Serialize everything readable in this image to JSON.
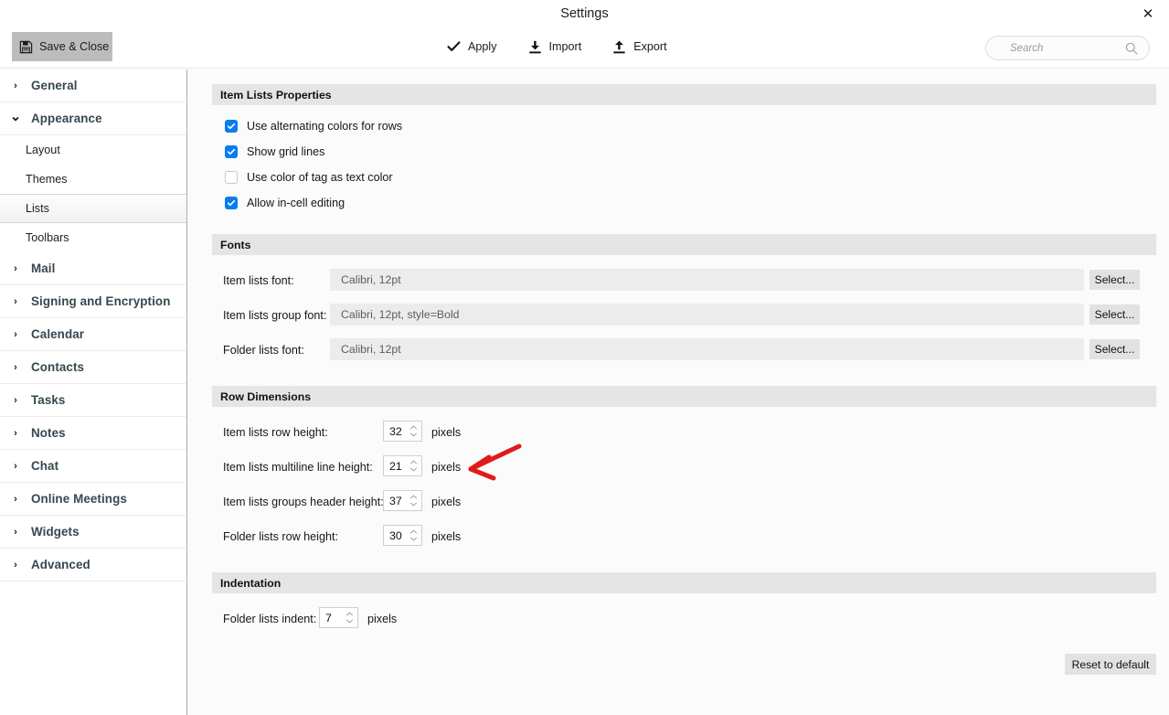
{
  "window": {
    "title": "Settings",
    "close_label": "✕"
  },
  "toolbar": {
    "save_close_label": "Save & Close",
    "apply_label": "Apply",
    "import_label": "Import",
    "export_label": "Export",
    "search_placeholder": "Search",
    "search_value": ""
  },
  "sidebar": {
    "items": [
      {
        "label": "General",
        "type": "group",
        "expanded": false
      },
      {
        "label": "Appearance",
        "type": "group",
        "expanded": true
      },
      {
        "label": "Layout",
        "type": "sub",
        "selected": false
      },
      {
        "label": "Themes",
        "type": "sub",
        "selected": false
      },
      {
        "label": "Lists",
        "type": "sub",
        "selected": true
      },
      {
        "label": "Toolbars",
        "type": "sub",
        "selected": false
      },
      {
        "label": "Mail",
        "type": "group",
        "expanded": false
      },
      {
        "label": "Signing and Encryption",
        "type": "group",
        "expanded": false
      },
      {
        "label": "Calendar",
        "type": "group",
        "expanded": false
      },
      {
        "label": "Contacts",
        "type": "group",
        "expanded": false
      },
      {
        "label": "Tasks",
        "type": "group",
        "expanded": false
      },
      {
        "label": "Notes",
        "type": "group",
        "expanded": false
      },
      {
        "label": "Chat",
        "type": "group",
        "expanded": false
      },
      {
        "label": "Online Meetings",
        "type": "group",
        "expanded": false
      },
      {
        "label": "Widgets",
        "type": "group",
        "expanded": false
      },
      {
        "label": "Advanced",
        "type": "group",
        "expanded": false
      }
    ]
  },
  "sections": {
    "item_lists_properties": {
      "title": "Item Lists Properties",
      "checkboxes": [
        {
          "label": "Use alternating colors for rows",
          "checked": true
        },
        {
          "label": "Show grid lines",
          "checked": true
        },
        {
          "label": "Use color of tag as text color",
          "checked": false
        },
        {
          "label": "Allow in-cell editing",
          "checked": true
        }
      ]
    },
    "fonts": {
      "title": "Fonts",
      "rows": [
        {
          "label": "Item lists font:",
          "value": "Calibri, 12pt",
          "button": "Select..."
        },
        {
          "label": "Item lists group font:",
          "value": "Calibri, 12pt, style=Bold",
          "button": "Select..."
        },
        {
          "label": "Folder lists font:",
          "value": "Calibri, 12pt",
          "button": "Select..."
        }
      ]
    },
    "row_dimensions": {
      "title": "Row Dimensions",
      "rows": [
        {
          "label": "Item lists row height:",
          "value": "32",
          "units": "pixels"
        },
        {
          "label": "Item lists multiline line height:",
          "value": "21",
          "units": "pixels"
        },
        {
          "label": "Item lists groups header height:",
          "value": "37",
          "units": "pixels"
        },
        {
          "label": "Folder lists row height:",
          "value": "30",
          "units": "pixels"
        }
      ]
    },
    "indentation": {
      "title": "Indentation",
      "rows": [
        {
          "label": "Folder lists indent:",
          "value": "7",
          "units": "pixels"
        }
      ]
    }
  },
  "footer": {
    "reset_label": "Reset to default"
  },
  "annotation": {
    "type": "arrow",
    "color": "#e01b1b",
    "points_to": "item-lists-multiline-line-height-spinner"
  },
  "colors": {
    "accent_checkbox": "#0a7cf0",
    "section_header_bg": "#e5e5e5",
    "save_button_bg": "#bcbcbc",
    "annotation_red": "#e01b1b"
  }
}
